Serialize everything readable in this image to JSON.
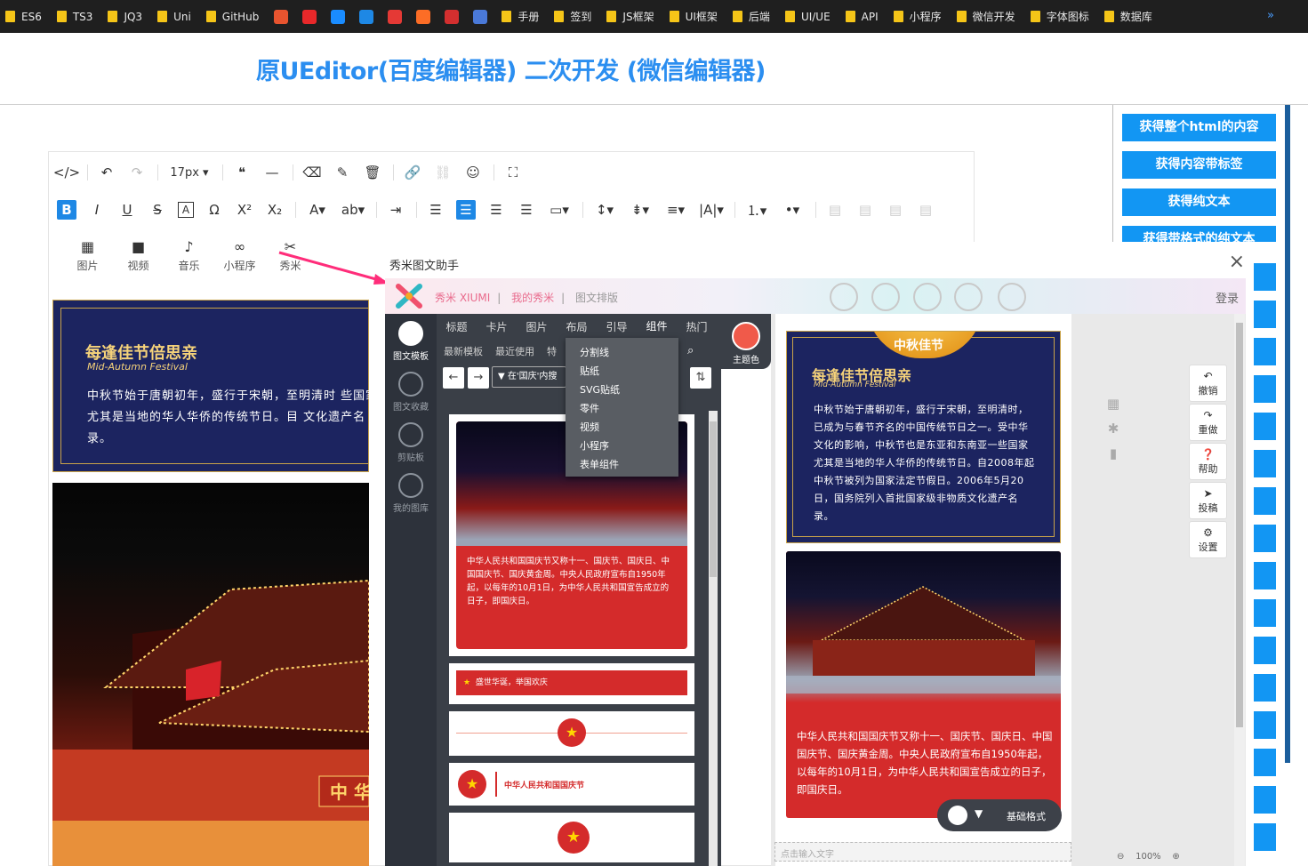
{
  "bookmarks": [
    {
      "label": "ES6",
      "type": "folder"
    },
    {
      "label": "TS3",
      "type": "folder"
    },
    {
      "label": "JQ3",
      "type": "folder"
    },
    {
      "label": "Uni",
      "type": "folder"
    },
    {
      "label": "GitHub",
      "type": "folder"
    },
    {
      "label": "",
      "type": "icon",
      "color": "#e8542f"
    },
    {
      "label": "",
      "type": "icon",
      "color": "#e8282a"
    },
    {
      "label": "",
      "type": "icon",
      "color": "#1a8cff"
    },
    {
      "label": "",
      "type": "icon",
      "color": "#1e88e5"
    },
    {
      "label": "",
      "type": "icon",
      "color": "#e53935"
    },
    {
      "label": "",
      "type": "icon",
      "color": "#fc6d26"
    },
    {
      "label": "",
      "type": "icon",
      "color": "#d32f2f"
    },
    {
      "label": "",
      "type": "icon",
      "color": "#4a79d8"
    },
    {
      "label": "手册",
      "type": "folder"
    },
    {
      "label": "签到",
      "type": "folder"
    },
    {
      "label": "JS框架",
      "type": "folder"
    },
    {
      "label": "UI框架",
      "type": "folder"
    },
    {
      "label": "后端",
      "type": "folder"
    },
    {
      "label": "UI/UE",
      "type": "folder"
    },
    {
      "label": "API",
      "type": "folder"
    },
    {
      "label": "小程序",
      "type": "folder"
    },
    {
      "label": "微信开发",
      "type": "folder"
    },
    {
      "label": "字体图标",
      "type": "folder"
    },
    {
      "label": "数据库",
      "type": "folder"
    }
  ],
  "bookmarks_more": "»",
  "page_title": "原UEditor(百度编辑器) 二次开发 (微信编辑器)",
  "right_buttons": [
    "获得整个html的内容",
    "获得内容带标签",
    "获得纯文本",
    "获得带格式的纯文本"
  ],
  "toolbar": {
    "font_size": "17px"
  },
  "insert_items": [
    {
      "icon": "image-icon",
      "glyph": "▦",
      "label": "图片"
    },
    {
      "icon": "video-icon",
      "glyph": "■",
      "label": "视频"
    },
    {
      "icon": "mic-icon",
      "glyph": "♪",
      "label": "音乐"
    },
    {
      "icon": "link-icon",
      "glyph": "∞",
      "label": "小程序"
    },
    {
      "icon": "xiumi-icon",
      "glyph": "✂",
      "label": "秀米"
    }
  ],
  "editor_card": {
    "heading": "每逢佳节倍思亲",
    "subtitle": "Mid-Autumn Festival",
    "body": "中秋节始于唐朝初年，盛行于宋朝，至明清时 些国家尤其是当地的华人华侨的传统节日。目 文化遗产名录。"
  },
  "editor_photo_text": "中 华",
  "modal": {
    "title": "秀米图文助手",
    "close": "×"
  },
  "xiumi": {
    "nav": [
      "秀米 XIUMI",
      "我的秀米",
      "图文排版"
    ],
    "login": "登录",
    "left": [
      "图文模板",
      "图文收藏",
      "剪贴板",
      "我的图库"
    ],
    "tabs": [
      "标题",
      "卡片",
      "图片",
      "布局",
      "引导",
      "组件",
      "热门"
    ],
    "active_tab": "组件",
    "subtabs": [
      "最新模板",
      "最近使用",
      "特"
    ],
    "theme_label": "主题色",
    "theme_color": "#f05a4a",
    "dropdown": [
      "分割线",
      "贴纸",
      "SVG贴纸",
      "零件",
      "视频",
      "小程序",
      "表单组件"
    ],
    "filter": "在'国庆'内搜",
    "tpl_text": "中华人民共和国国庆节又称十一、国庆节、国庆日、中国国庆节、国庆黄金周。中央人民政府宣布自1950年起，以每年的10月1日，为中华人民共和国宣告成立的日子，即国庆日。",
    "tpl_banner": "盛世华诞，举国欢庆",
    "tpl_title3": "中华人民共和国国庆节"
  },
  "preview": {
    "moon_title": "中秋佳节",
    "heading": "每逢佳节倍思亲",
    "subtitle": "Mid-Autumn Festival",
    "body": "中秋节始于唐朝初年，盛行于宋朝，至明清时，已成为与春节齐名的中国传统节日之一。受中华文化的影响，中秋节也是东亚和东南亚一些国家尤其是当地的华人华侨的传统节日。自2008年起中秋节被列为国家法定节假日。2006年5月20日，国务院列入首批国家级非物质文化遗产名录。",
    "card2": "中华人民共和国国庆节又称十一、国庆节、国庆日、中国国庆节、国庆黄金周。中央人民政府宣布自1950年起，以每年的10月1日，为中华人民共和国宣告成立的日子，即国庆日。",
    "format_label": "基础格式",
    "input_placeholder": "点击输入文字",
    "zoom": "100%"
  },
  "side_tools": [
    {
      "icon": "undo-icon",
      "glyph": "↶",
      "label": "撤销"
    },
    {
      "icon": "redo-icon",
      "glyph": "↷",
      "label": "重做"
    },
    {
      "icon": "help-icon",
      "glyph": "❓",
      "label": "帮助"
    },
    {
      "icon": "send-icon",
      "glyph": "➤",
      "label": "投稿"
    },
    {
      "icon": "gear-icon",
      "glyph": "⚙",
      "label": "设置"
    }
  ]
}
